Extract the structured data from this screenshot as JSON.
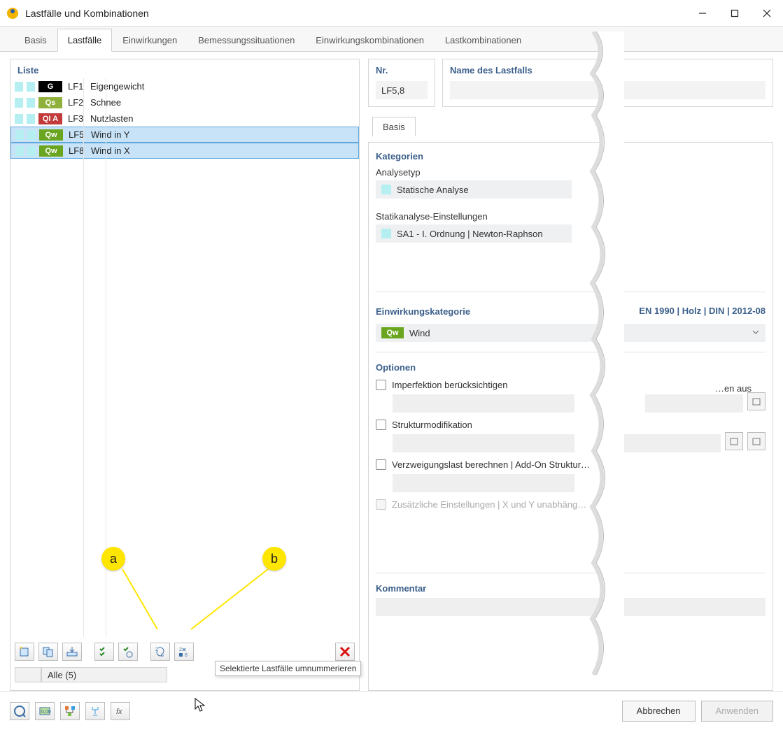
{
  "window": {
    "title": "Lastfälle und Kombinationen"
  },
  "tabs": [
    "Basis",
    "Lastfälle",
    "Einwirkungen",
    "Bemessungssituationen",
    "Einwirkungskombinationen",
    "Lastkombinationen"
  ],
  "activeTab": 1,
  "list": {
    "heading": "Liste",
    "items": [
      {
        "badge": "G",
        "badgeBg": "#000000",
        "id": "LF1",
        "name": "Eigengewicht",
        "selected": false
      },
      {
        "badge": "Qs",
        "badgeBg": "#8fb03a",
        "id": "LF2",
        "name": "Schnee",
        "selected": false
      },
      {
        "badge": "QI A",
        "badgeBg": "#c23a3a",
        "id": "LF3",
        "name": "Nutzlasten",
        "selected": false
      },
      {
        "badge": "Qw",
        "badgeBg": "#6aa51f",
        "id": "LF5",
        "name": "Wind in Y",
        "selected": true
      },
      {
        "badge": "Qw",
        "badgeBg": "#6aa51f",
        "id": "LF8",
        "name": "Wind in X",
        "selected": true
      }
    ],
    "filterLabel": "Alle (5)",
    "tooltip": "Selektierte Lastfälle umnummerieren"
  },
  "annotations": {
    "a": "a",
    "b": "b"
  },
  "right": {
    "nr": {
      "label": "Nr.",
      "value": "LF5,8"
    },
    "name": {
      "label": "Name des Lastfalls",
      "value": ""
    },
    "subtab": "Basis",
    "kategorien": {
      "heading": "Kategorien",
      "analyseLabel": "Analysetyp",
      "analyseValue": "Statische Analyse",
      "statikLabel": "Statikanalyse-Einstellungen",
      "statikValue": "SA1 - I. Ordnung | Newton-Raphson"
    },
    "einwirk": {
      "heading": "Einwirkungskategorie",
      "code": "EN 1990 | Holz | DIN | 2012-08",
      "badge": "Qw",
      "value": "Wind"
    },
    "optionen": {
      "heading": "Optionen",
      "right_text": "…en aus",
      "o1": "Imperfektion berücksichtigen",
      "o2": "Strukturmodifikation",
      "o3": "Verzweigungslast berechnen | Add-On Struktur…",
      "o4": "Zusätzliche Einstellungen | X und Y unabhäng…"
    },
    "kommentar": {
      "heading": "Kommentar"
    }
  },
  "footer": {
    "cancel": "Abbrechen",
    "apply": "Anwenden"
  }
}
